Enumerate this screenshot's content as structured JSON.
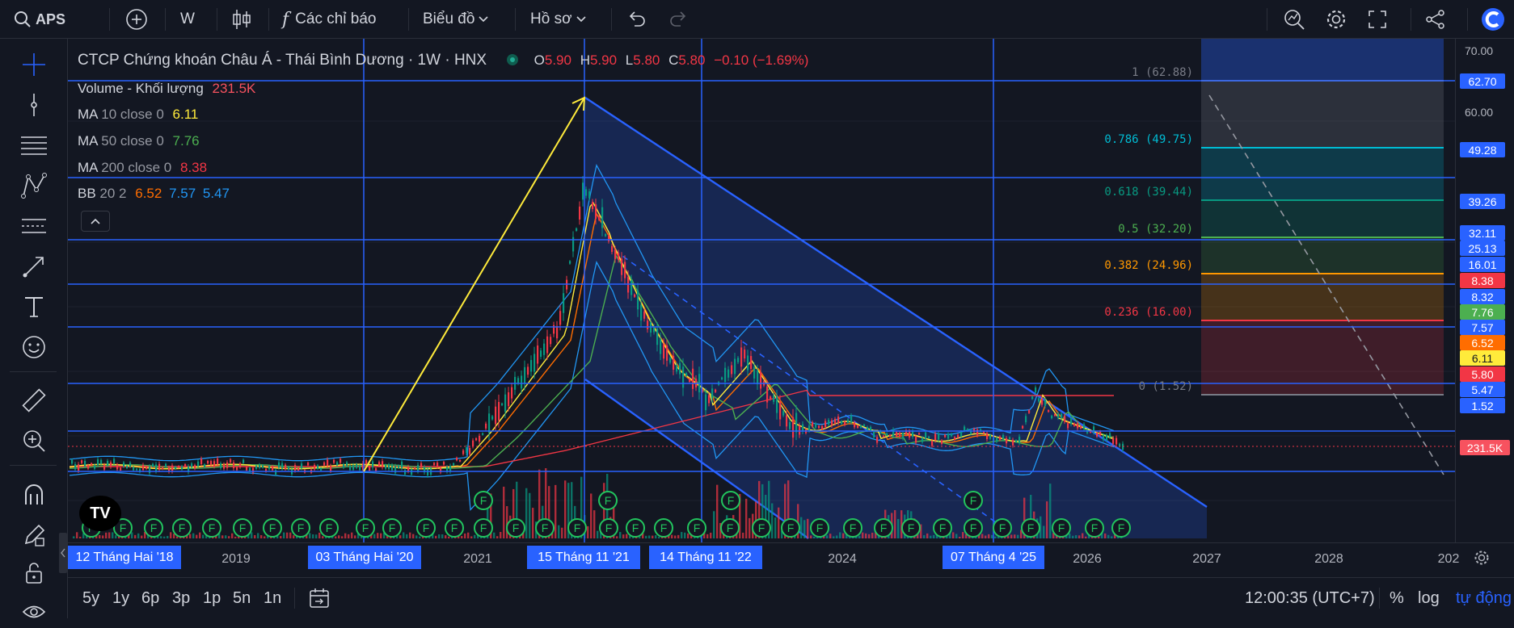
{
  "topbar": {
    "symbol": "APS",
    "interval": "W",
    "indicators_label": "Các chỉ báo",
    "chart_type_label": "Biểu đồ",
    "profile_label": "Hồ sơ"
  },
  "legend": {
    "title": "CTCP Chứng khoán Châu Á - Thái Bình Dương · 1W · HNX",
    "o_label": "O",
    "o": "5.90",
    "h_label": "H",
    "h": "5.90",
    "l_label": "L",
    "l": "5.80",
    "c_label": "C",
    "c": "5.80",
    "change": "−0.10 (−1.69%)",
    "volume_label": "Volume - Khối lượng",
    "volume": "231.5K",
    "ma10_label": "MA",
    "ma10_params": "10 close 0",
    "ma10": "6.11",
    "ma50_label": "MA",
    "ma50_params": "50 close 0",
    "ma50": "7.76",
    "ma200_label": "MA",
    "ma200_params": "200 close 0",
    "ma200": "8.38",
    "bb_label": "BB",
    "bb_params": "20 2",
    "bb_basis": "6.52",
    "bb_upper": "7.57",
    "bb_lower": "5.47"
  },
  "price_axis": {
    "ticks": [
      "70.00",
      "60.00"
    ],
    "labels": [
      {
        "text": "62.70",
        "color": "#2962ff"
      },
      {
        "text": "49.28",
        "color": "#2962ff"
      },
      {
        "text": "39.26",
        "color": "#2962ff"
      },
      {
        "text": "32.11",
        "color": "#2962ff"
      },
      {
        "text": "25.13",
        "color": "#2962ff"
      },
      {
        "text": "16.01",
        "color": "#2962ff"
      },
      {
        "text": "8.38",
        "color": "#f23645"
      },
      {
        "text": "8.32",
        "color": "#2962ff"
      },
      {
        "text": "7.76",
        "color": "#4caf50"
      },
      {
        "text": "7.57",
        "color": "#2962ff"
      },
      {
        "text": "6.52",
        "color": "#ff6d00"
      },
      {
        "text": "6.11",
        "color": "#ffeb3b"
      },
      {
        "text": "5.80",
        "color": "#f23645"
      },
      {
        "text": "5.47",
        "color": "#2962ff"
      },
      {
        "text": "1.52",
        "color": "#2962ff"
      },
      {
        "text": "231.5K",
        "color": "#f7525f"
      }
    ]
  },
  "fib_levels": [
    {
      "text": "1 (62.88)",
      "color": "#787b86"
    },
    {
      "text": "0.786 (49.75)",
      "color": "#00bcd4"
    },
    {
      "text": "0.618 (39.44)",
      "color": "#089981"
    },
    {
      "text": "0.5 (32.20)",
      "color": "#4caf50"
    },
    {
      "text": "0.382 (24.96)",
      "color": "#ff9800"
    },
    {
      "text": "0.236 (16.00)",
      "color": "#f23645"
    },
    {
      "text": "0 (1.52)",
      "color": "#787b86"
    }
  ],
  "time_axis": {
    "highlighted": [
      "12 Tháng Hai '18",
      "03 Tháng Hai '20",
      "15 Tháng 11 '21",
      "14 Tháng 11 '22",
      "07 Tháng 4 '25"
    ],
    "years": [
      "2019",
      "2021",
      "2024",
      "2026",
      "2027",
      "2028",
      "202"
    ]
  },
  "bottombar": {
    "ranges": [
      "5y",
      "1y",
      "6p",
      "3p",
      "1p",
      "5n",
      "1n"
    ],
    "clock": "12:00:35 (UTC+7)",
    "percent": "%",
    "log": "log",
    "auto": "tự động"
  },
  "marker_letter": "F",
  "logo_text": "TV",
  "colors": {
    "accent": "#2962ff",
    "background": "#131722",
    "up": "#089981",
    "down": "#f23645"
  }
}
